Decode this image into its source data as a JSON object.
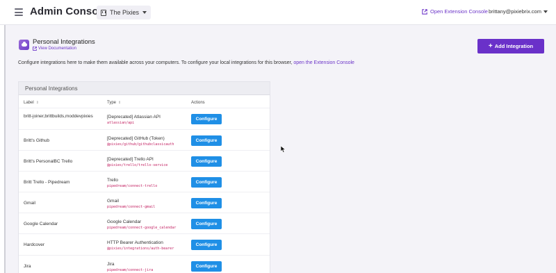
{
  "topbar": {
    "title": "Admin Console",
    "org": "The Pixies",
    "extension_link": "Open Extension Console",
    "user": "brittany@pixiebrix.com"
  },
  "page": {
    "title": "Personal Integrations",
    "doc_link": "View Documentation",
    "add_button": "Add Integration",
    "intro_text": "Configure integrations here to make them available across your computers. To configure your local integrations for this browser, ",
    "intro_link": "open the Extension Console"
  },
  "table": {
    "card_title": "Personal Integrations",
    "columns": {
      "label": "Label",
      "type": "Type",
      "actions": "Actions"
    },
    "configure_label": "Configure",
    "rows": [
      {
        "label": "britt-joiner,brittbuilds,moddevpixies",
        "type": "[Deprecated] Atlassian API",
        "id": "atlassian/api"
      },
      {
        "label": "Britt's Github",
        "type": "[Deprecated] GitHub (Token)",
        "id": "@pixies/github/githubclassicauth"
      },
      {
        "label": "Britt's PersonalBC Trello",
        "type": "[Deprecated] Trello API",
        "id": "@pixies/trello/trello-service"
      },
      {
        "label": "Britt Trello - Pipedream",
        "type": "Trello",
        "id": "pipedream/connect-trello"
      },
      {
        "label": "Gmail",
        "type": "Gmail",
        "id": "pipedream/connect-gmail"
      },
      {
        "label": "Google Calendar",
        "type": "Google Calendar",
        "id": "pipedream/connect-google_calendar"
      },
      {
        "label": "Hardcover",
        "type": "HTTP Bearer Authentication",
        "id": "@pixies/integrations/auth-bearer"
      },
      {
        "label": "Jira",
        "type": "Jira",
        "id": "pipedream/connect-jira"
      }
    ]
  },
  "colors": {
    "accent": "#6a31c9",
    "configure": "#1f8fe6",
    "code": "#c21d5f"
  }
}
